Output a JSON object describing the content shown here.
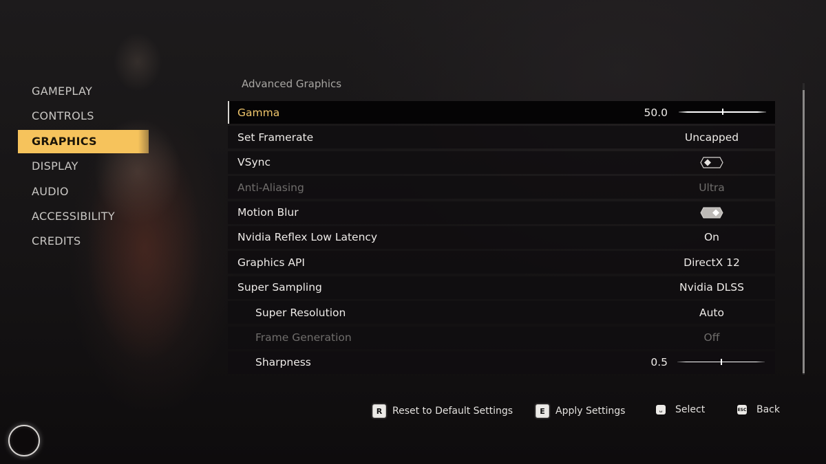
{
  "sidebar": {
    "items": [
      {
        "label": "GAMEPLAY",
        "active": false
      },
      {
        "label": "CONTROLS",
        "active": false
      },
      {
        "label": "GRAPHICS",
        "active": true
      },
      {
        "label": "DISPLAY",
        "active": false
      },
      {
        "label": "AUDIO",
        "active": false
      },
      {
        "label": "ACCESSIBILITY",
        "active": false
      },
      {
        "label": "CREDITS",
        "active": false
      }
    ]
  },
  "panel": {
    "title": "Advanced Graphics",
    "settings": [
      {
        "label": "Gamma",
        "type": "slider",
        "value": "50.0",
        "fraction": 0.5,
        "selected": true
      },
      {
        "label": "Set Framerate",
        "type": "option",
        "value": "Uncapped"
      },
      {
        "label": "VSync",
        "type": "toggle",
        "value": "off"
      },
      {
        "label": "Anti-Aliasing",
        "type": "option",
        "value": "Ultra",
        "disabled": true
      },
      {
        "label": "Motion Blur",
        "type": "toggle",
        "value": "on"
      },
      {
        "label": "Nvidia Reflex Low Latency",
        "type": "option",
        "value": "On"
      },
      {
        "label": "Graphics API",
        "type": "option",
        "value": "DirectX 12"
      },
      {
        "label": "Super Sampling",
        "type": "option",
        "value": "Nvidia DLSS"
      },
      {
        "label": "Super Resolution",
        "type": "option",
        "value": "Auto",
        "sub": true
      },
      {
        "label": "Frame Generation",
        "type": "option",
        "value": "Off",
        "sub": true,
        "disabled": true
      },
      {
        "label": "Sharpness",
        "type": "slider",
        "value": "0.5",
        "fraction": 0.5,
        "sub": true
      }
    ]
  },
  "footer": {
    "hints": [
      {
        "key": "R",
        "label": "Reset to Default Settings"
      },
      {
        "key": "E",
        "label": "Apply Settings"
      },
      {
        "key": "␣",
        "label": "Select"
      },
      {
        "key": "ESC",
        "label": "Back"
      }
    ]
  },
  "colors": {
    "accent": "#f6c35c",
    "selected_label": "#f0c66c",
    "disabled": "#6f6d6b"
  }
}
